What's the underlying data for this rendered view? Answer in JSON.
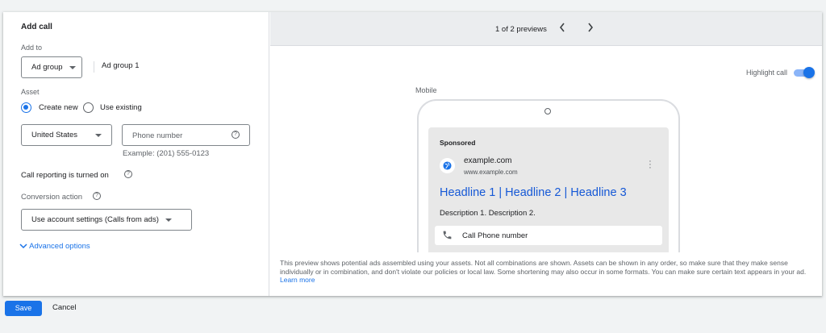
{
  "form": {
    "title": "Add call",
    "add_to_label": "Add to",
    "add_to_select": "Ad group",
    "ad_group_name": "Ad group 1",
    "asset_label": "Asset",
    "radio_create_new": "Create new",
    "radio_use_existing": "Use existing",
    "country_select": "United States",
    "phone_placeholder": "Phone number",
    "phone_example": "Example: (201) 555-0123",
    "call_reporting_text": "Call reporting is turned on",
    "conversion_label": "Conversion action",
    "conversion_select": "Use account settings (Calls from ads)",
    "advanced_options": "Advanced options"
  },
  "preview": {
    "counter": "1 of 2 previews",
    "highlight_label": "Highlight call",
    "mobile_label": "Mobile",
    "sponsored": "Sponsored",
    "domain": "example.com",
    "url": "www.example.com",
    "headline": "Headline 1 | Headline 2 | Headline 3",
    "description": "Description 1. Description 2.",
    "call_text": "Call Phone number",
    "disclaimer": "This preview shows potential ads assembled using your assets. Not all combinations are shown. Assets can be shown in any order, so make sure that they make sense individually or in combination, and don't violate our policies or local law. Some shortening may also occur in some formats. You can make sure certain text appears in your ad.",
    "learn_more": "Learn more"
  },
  "actions": {
    "save": "Save",
    "cancel": "Cancel"
  },
  "colors": {
    "accent": "#1a73e8",
    "headline": "#1558d6"
  }
}
